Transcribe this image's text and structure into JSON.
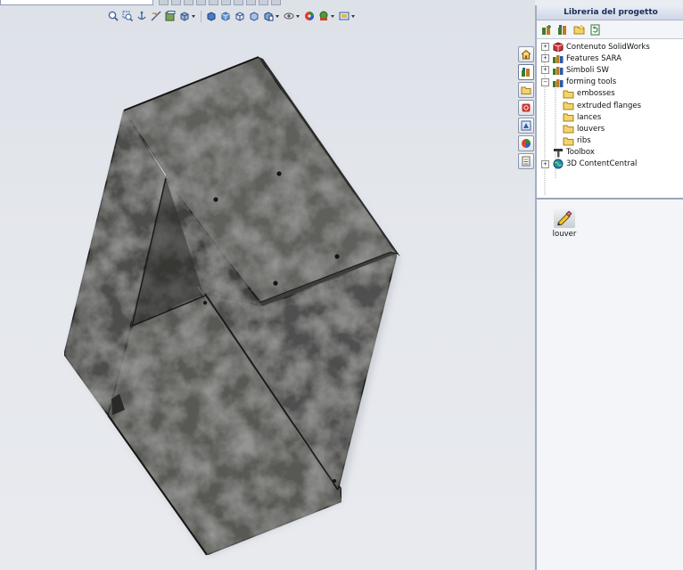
{
  "panel": {
    "title": "Libreria del progetto",
    "tree": [
      {
        "label": "Contenuto SolidWorks",
        "expander": "+",
        "icon": "solidworks-content-icon"
      },
      {
        "label": "Features SARA",
        "expander": "+",
        "icon": "library-features-icon"
      },
      {
        "label": "Simboli SW",
        "expander": "+",
        "icon": "library-features-icon"
      },
      {
        "label": "forming tools",
        "expander": "−",
        "icon": "library-features-icon"
      },
      {
        "label": "embosses",
        "icon": "folder-icon"
      },
      {
        "label": "extruded flanges",
        "icon": "folder-icon"
      },
      {
        "label": "lances",
        "icon": "folder-icon"
      },
      {
        "label": "louvers",
        "icon": "folder-icon"
      },
      {
        "label": "ribs",
        "icon": "folder-icon"
      },
      {
        "label": "Toolbox",
        "icon": "toolbox-icon"
      },
      {
        "label": "3D ContentCentral",
        "expander": "+",
        "icon": "globe-icon"
      }
    ],
    "item": {
      "label": "louver",
      "icon": "forming-tool-icon"
    }
  },
  "colors": {
    "sheet_metal": "#4b4b48",
    "panel_title": "#1b2d55",
    "folder": "#f3d46b"
  }
}
